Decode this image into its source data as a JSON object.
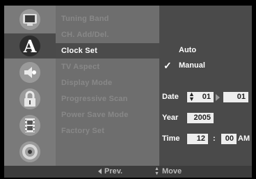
{
  "side_icons": [
    "tv-icon",
    "language-icon",
    "audio-icon",
    "lock-icon",
    "film-icon",
    "disc-icon"
  ],
  "side_language_letter": "A",
  "menu": {
    "items": [
      "Tuning Band",
      "CH. Add/Del.",
      "Clock Set",
      "TV Aspect",
      "Display Mode",
      "Progressive Scan",
      "Power Save Mode",
      "Factory Set"
    ],
    "selected": "Clock Set"
  },
  "panel": {
    "auto_label": "Auto",
    "manual_label": "Manual",
    "check_mark": "✓",
    "date_label": "Date",
    "date_month": "01",
    "date_day": "01",
    "year_label": "Year",
    "year_value": "2005",
    "time_label": "Time",
    "time_hour": "12",
    "time_sep": ":",
    "time_minute": "00",
    "time_ampm": "AM"
  },
  "footer": {
    "prev_label": "Prev.",
    "move_label": "Move"
  }
}
